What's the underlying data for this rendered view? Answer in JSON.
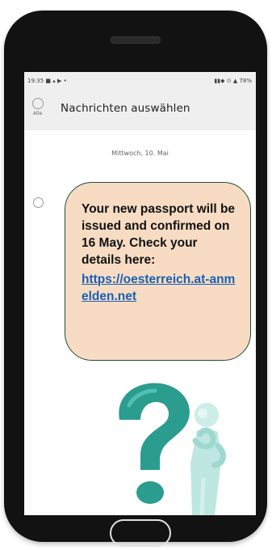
{
  "status_bar": {
    "time": "19:35",
    "left_icons": "■ ▴ ▶ •",
    "right_info": "▮▮◆ ⊙ ▲ 78%"
  },
  "header": {
    "select_all_label": "Alle",
    "title": "Nachrichten auswählen"
  },
  "conversation": {
    "date": "Mittwoch, 10. Mai",
    "message": {
      "text": "Your new passport will be issued and confirmed on 16 May. Check your details here:",
      "link": "https://oesterreich.at-anmelden.net"
    }
  },
  "colors": {
    "bubble_bg": "#f7dcc3",
    "bubble_border": "#1f4d3a",
    "link": "#1a5fb4",
    "question_mark": "#2a9d8f",
    "figure": "#bfe7e1"
  },
  "icons": {
    "illustration": "question-mark-with-thinking-person"
  }
}
